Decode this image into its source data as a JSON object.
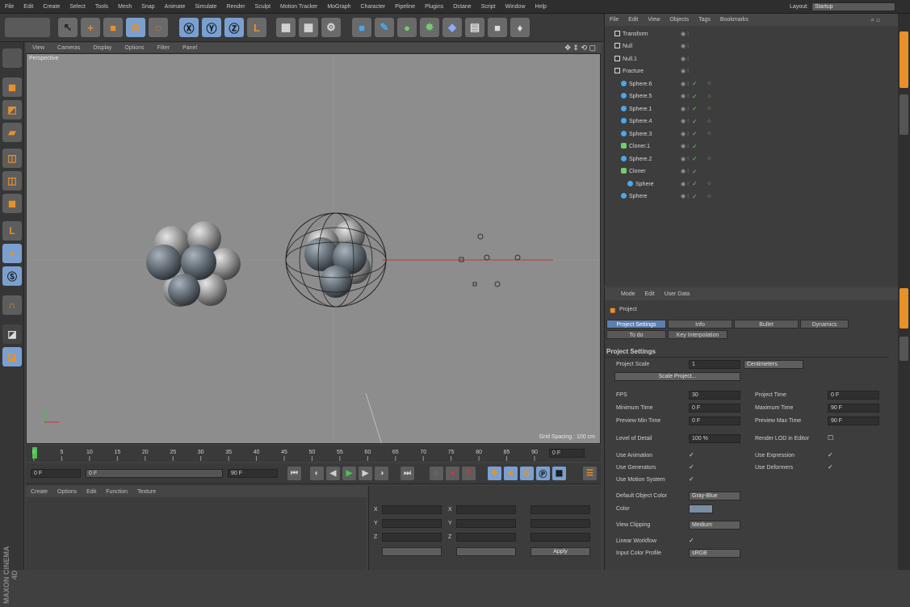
{
  "menubar": {
    "items": [
      "File",
      "Edit",
      "Create",
      "Select",
      "Tools",
      "Mesh",
      "Snap",
      "Animate",
      "Simulate",
      "Render",
      "Sculpt",
      "Motion Tracker",
      "MoGraph",
      "Character",
      "Pipeline",
      "Plugins",
      "Octane",
      "Script",
      "Window",
      "Help"
    ],
    "layout_label": "Layout:",
    "layout_value": "Startup"
  },
  "viewport": {
    "menu": [
      "View",
      "Cameras",
      "Display",
      "Options",
      "Filter",
      "Panel"
    ],
    "label": "Perspective",
    "grid_spacing": "Grid Spacing : 100 cm"
  },
  "timeline": {
    "ticks": [
      "0",
      "5",
      "10",
      "15",
      "20",
      "25",
      "30",
      "35",
      "40",
      "45",
      "50",
      "55",
      "60",
      "65",
      "70",
      "75",
      "80",
      "85",
      "90"
    ],
    "end_frame": "0 F"
  },
  "transport": {
    "start": "0 F",
    "current": "0 F",
    "end": "90 F"
  },
  "material_manager": {
    "menu": [
      "Create",
      "Options",
      "Edit",
      "Function",
      "Texture"
    ]
  },
  "coordinates": {
    "axes": [
      "X",
      "Y",
      "Z"
    ],
    "apply": "Apply"
  },
  "branding": "MAXON CINEMA 4D",
  "object_manager": {
    "menu": [
      "File",
      "Edit",
      "View",
      "Objects",
      "Tags",
      "Bookmarks"
    ],
    "objects": [
      {
        "name": "Transform",
        "kind": "null",
        "depth": 0
      },
      {
        "name": "Null",
        "kind": "null",
        "depth": 0
      },
      {
        "name": "Null.1",
        "kind": "null",
        "depth": 0
      },
      {
        "name": "Fracture",
        "kind": "null",
        "depth": 0
      },
      {
        "name": "Sphere.6",
        "kind": "sphere",
        "depth": 1
      },
      {
        "name": "Sphere.5",
        "kind": "sphere",
        "depth": 1
      },
      {
        "name": "Sphere.1",
        "kind": "sphere",
        "depth": 1
      },
      {
        "name": "Sphere.4",
        "kind": "sphere",
        "depth": 1
      },
      {
        "name": "Sphere.3",
        "kind": "sphere",
        "depth": 1
      },
      {
        "name": "Cloner.1",
        "kind": "cloner",
        "depth": 1
      },
      {
        "name": "Sphere.2",
        "kind": "sphere",
        "depth": 1
      },
      {
        "name": "Cloner",
        "kind": "cloner",
        "depth": 1
      },
      {
        "name": "Sphere",
        "kind": "sphere",
        "depth": 2
      },
      {
        "name": "Sphere",
        "kind": "sphere",
        "depth": 1
      }
    ]
  },
  "attributes": {
    "menu": [
      "Mode",
      "Edit",
      "User Data"
    ],
    "title": "Project",
    "tabs": [
      "Project Settings",
      "Info",
      "Bullet",
      "Dynamics",
      "To do",
      "Key Interpolation"
    ],
    "section": "Project Settings",
    "project_scale_label": "Project Scale",
    "project_scale_value": "1",
    "project_scale_unit": "Centimeters",
    "scale_button": "Scale Project...",
    "fps_label": "FPS",
    "fps_value": "30",
    "project_time_label": "Project Time",
    "project_time_value": "0 F",
    "min_time_label": "Minimum Time",
    "min_time_value": "0 F",
    "max_time_label": "Maximum Time",
    "max_time_value": "90 F",
    "prev_min_label": "Preview Min Time",
    "prev_min_value": "0 F",
    "prev_max_label": "Preview Max Time",
    "prev_max_value": "90 F",
    "lod_label": "Level of Detail",
    "lod_value": "100 %",
    "render_lod_label": "Render LOD in Editor",
    "use_anim_label": "Use Animation",
    "use_expr_label": "Use Expression",
    "use_gen_label": "Use Generators",
    "use_def_label": "Use Deformers",
    "use_motion_label": "Use Motion System",
    "obj_color_label": "Default Object Color",
    "obj_color_value": "Gray-Blue",
    "color_label": "Color",
    "view_clip_label": "View Clipping",
    "view_clip_value": "Medium",
    "linear_wf_label": "Linear Workflow",
    "input_profile_label": "Input Color Profile",
    "input_profile_value": "sRGB"
  },
  "colors": {
    "accent": "#5a7fb0",
    "sphere": "#4aa7ee",
    "check": "#5fd15f",
    "tag": "#e8a33a",
    "orange_tool": "#e8902a"
  }
}
